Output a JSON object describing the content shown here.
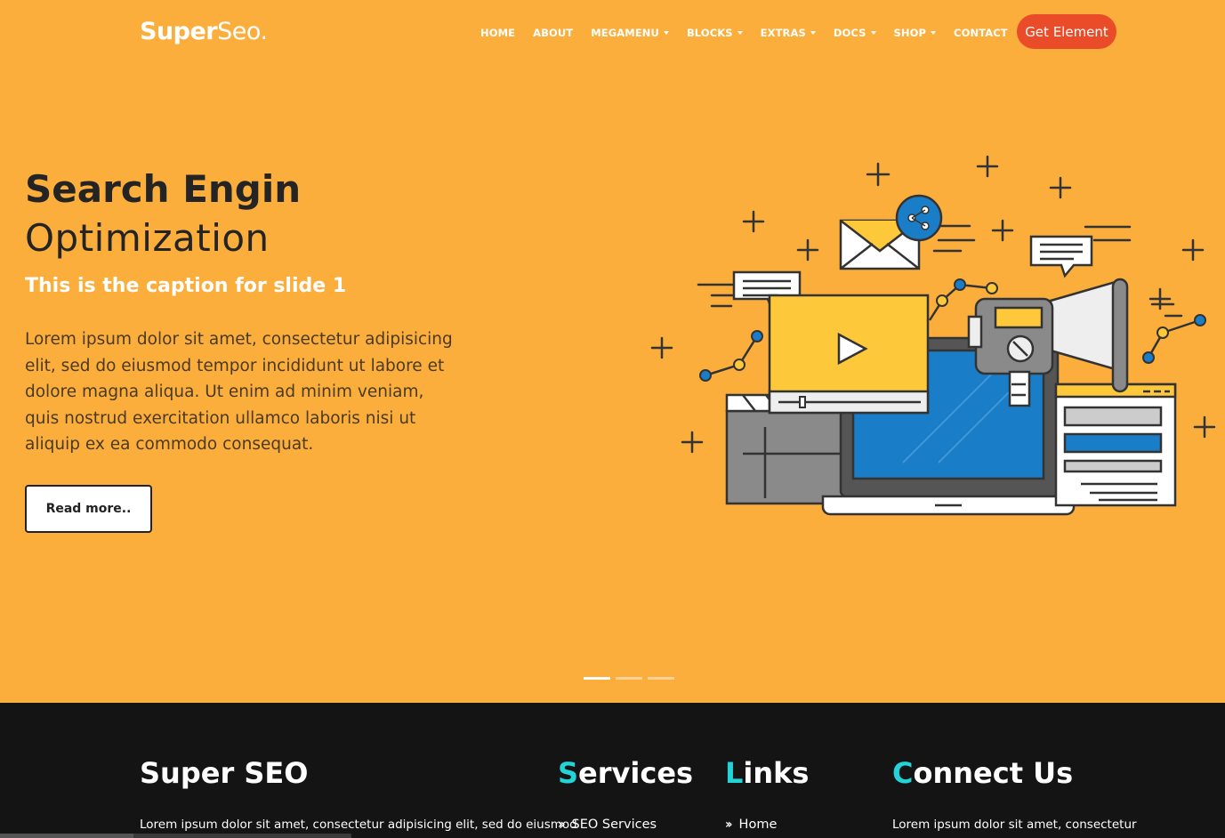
{
  "header": {
    "logo_bold": "Super",
    "logo_light": "Seo.",
    "nav": [
      {
        "label": "HOME",
        "dropdown": false
      },
      {
        "label": "ABOUT",
        "dropdown": false
      },
      {
        "label": "MEGAMENU",
        "dropdown": true
      },
      {
        "label": "BLOCKS",
        "dropdown": true
      },
      {
        "label": "EXTRAS",
        "dropdown": true
      },
      {
        "label": "DOCS",
        "dropdown": true
      },
      {
        "label": "SHOP",
        "dropdown": true
      },
      {
        "label": "CONTACT",
        "dropdown": false
      }
    ],
    "cta_label": "Get Element"
  },
  "hero": {
    "title_line1": "Search Engin",
    "title_line2": "Optimization",
    "caption": "This is the caption for slide 1",
    "text": "Lorem ipsum dolor sit amet, consectetur adipisicing elit, sed do eiusmod tempor incididunt ut labore et dolore magna aliqua. Ut enim ad minim veniam, quis nostrud exercitation ullamco laboris nisi ut aliquip ex ea commodo consequat.",
    "button_label": "Read more..",
    "slides": 3,
    "active_slide": 1
  },
  "footer": {
    "col1": {
      "title": "Super SEO",
      "text": "Lorem ipsum dolor sit amet, consectetur adipisicing elit, sed do eiusmod"
    },
    "col2": {
      "title_accent": "S",
      "title_rest": "ervices",
      "items": [
        "SEO Services"
      ]
    },
    "col3": {
      "title_accent": "L",
      "title_rest": "inks",
      "items": [
        "Home"
      ]
    },
    "col4": {
      "title_accent": "C",
      "title_rest": "onnect Us",
      "text": "Lorem ipsum dolor sit amet, consectetur"
    }
  },
  "colors": {
    "hero_bg": "#fbae3c",
    "cta_bg": "#ea4c2a",
    "footer_bg": "#141414",
    "footer_accent": "#22d3d8",
    "illus_blue": "#1a7dc7",
    "illus_yellow": "#fdc93b"
  },
  "icons": [
    "caret-down-icon",
    "double-chevron-right-icon",
    "seo-illustration"
  ]
}
